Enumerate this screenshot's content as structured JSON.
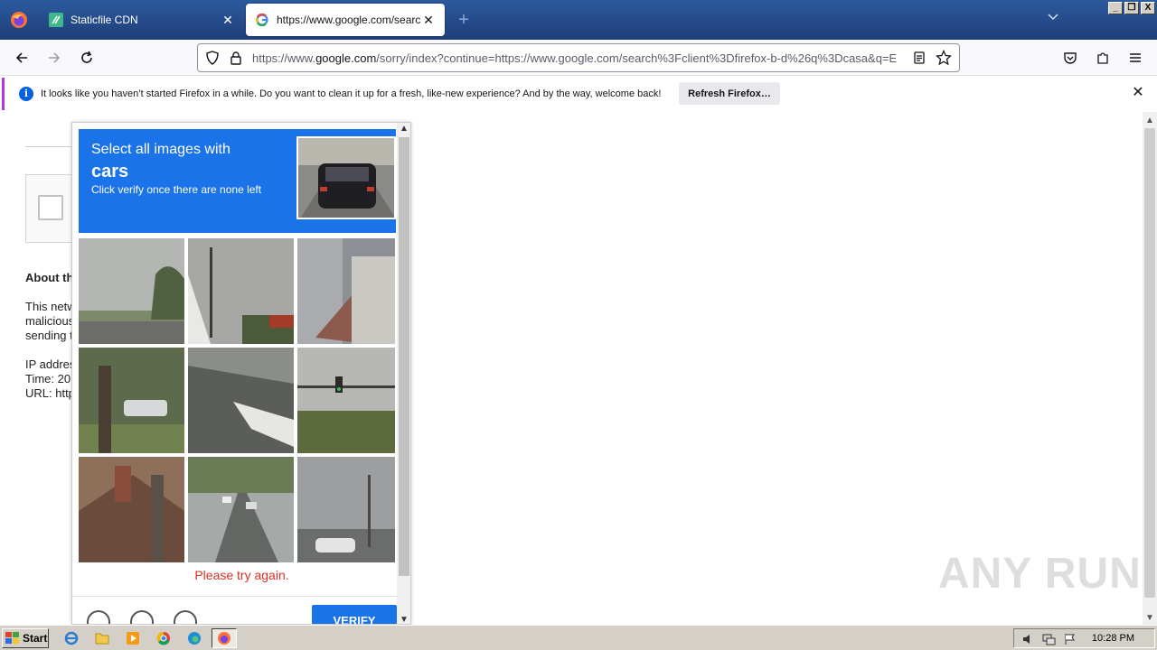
{
  "browser": {
    "tabs": [
      {
        "title": "Staticfile CDN",
        "active": false
      },
      {
        "title": "https://www.google.com/search?c",
        "active": true
      }
    ],
    "window_controls": [
      "_",
      "❐",
      "X"
    ]
  },
  "navbar": {
    "url_prefix": "https://www.",
    "url_domain": "google.com",
    "url_suffix": "/sorry/index?continue=https://www.google.com/search%3Fclient%3Dfirefox-b-d%26q%3Dcasa&q=E"
  },
  "notification": {
    "message": "It looks like you haven’t started Firefox in a while. Do you want to clean it up for a fresh, like-new experience? And by the way, welcome back!",
    "button": "Refresh Firefox…"
  },
  "page": {
    "about_heading": "About th",
    "lines": [
      "This netw",
      "malicious",
      "sending t",
      "IP addres",
      "Time: 20",
      "URL: http"
    ]
  },
  "challenge": {
    "instruction_line1": "Select all images with",
    "target": "cars",
    "instruction_line3": "Click verify once there are none left",
    "error": "Please try again.",
    "verify_label": "VERIFY"
  },
  "watermark": "ANY RUN",
  "taskbar": {
    "start": "Start",
    "clock": "10:28 PM"
  }
}
